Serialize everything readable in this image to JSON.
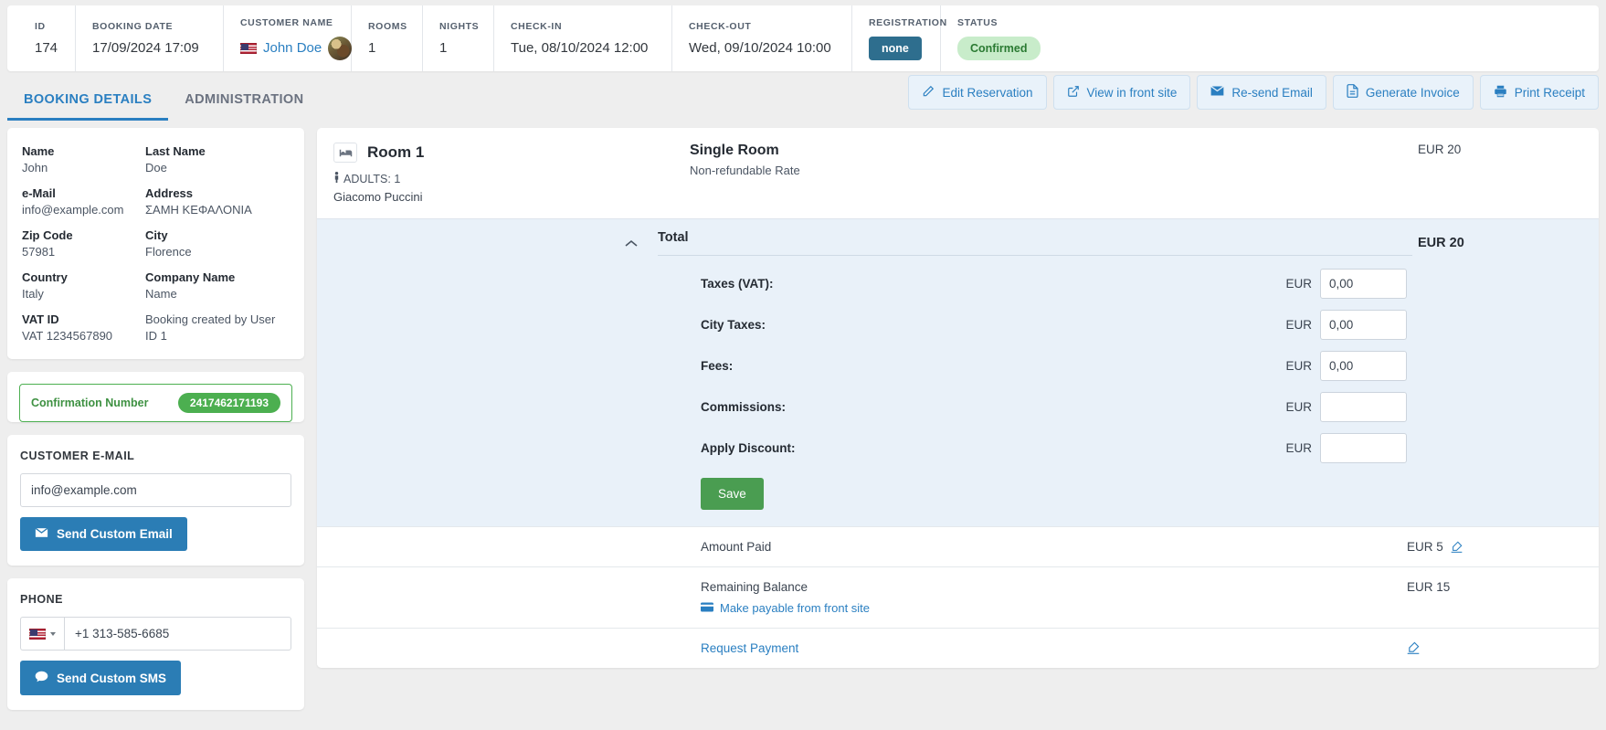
{
  "header": {
    "cells": [
      {
        "label": "ID",
        "value": "174"
      },
      {
        "label": "BOOKING DATE",
        "value": "17/09/2024 17:09"
      },
      {
        "label": "CUSTOMER NAME",
        "value": "John Doe"
      },
      {
        "label": "ROOMS",
        "value": "1"
      },
      {
        "label": "NIGHTS",
        "value": "1"
      },
      {
        "label": "CHECK-IN",
        "value": "Tue, 08/10/2024 12:00"
      },
      {
        "label": "CHECK-OUT",
        "value": "Wed, 09/10/2024 10:00"
      },
      {
        "label": "REGISTRATION",
        "value": "none"
      },
      {
        "label": "STATUS",
        "value": "Confirmed"
      }
    ]
  },
  "tabs": [
    {
      "label": "BOOKING DETAILS",
      "active": true
    },
    {
      "label": "ADMINISTRATION",
      "active": false
    }
  ],
  "actions": [
    {
      "label": "Edit Reservation",
      "icon": "pencil-icon"
    },
    {
      "label": "View in front site",
      "icon": "external-link-icon"
    },
    {
      "label": "Re-send Email",
      "icon": "envelope-icon"
    },
    {
      "label": "Generate Invoice",
      "icon": "document-icon"
    },
    {
      "label": "Print Receipt",
      "icon": "printer-icon"
    }
  ],
  "customer": {
    "fields": [
      {
        "label": "Name",
        "value": "John"
      },
      {
        "label": "Last Name",
        "value": "Doe"
      },
      {
        "label": "e-Mail",
        "value": "info@example.com"
      },
      {
        "label": "Address",
        "value": "ΣΑΜΗ ΚΕΦΑΛΟΝΙΑ"
      },
      {
        "label": "Zip Code",
        "value": "57981"
      },
      {
        "label": "City",
        "value": "Florence"
      },
      {
        "label": "Country",
        "value": "Italy"
      },
      {
        "label": "Company Name",
        "value": "Name"
      },
      {
        "label": "VAT ID",
        "value": "VAT 1234567890"
      },
      {
        "label": "Booking created by User",
        "value": "ID 1"
      }
    ]
  },
  "confirmation": {
    "label": "Confirmation Number",
    "number": "2417462171193"
  },
  "email_panel": {
    "title": "CUSTOMER E-MAIL",
    "value": "info@example.com",
    "placeholder": "info@example.com",
    "button": "Send Custom Email"
  },
  "phone_panel": {
    "title": "PHONE",
    "value": "+1 313-585-6685",
    "placeholder": "+1 313-585-6685",
    "button": "Send Custom SMS"
  },
  "room": {
    "title": "Room 1",
    "adults": "ADULTS: 1",
    "guest": "Giacomo Puccini",
    "rate_name": "Single Room",
    "rate_sub": "Non-refundable Rate",
    "price": "EUR 20"
  },
  "total": {
    "label": "Total",
    "amount": "EUR 20",
    "currency": "EUR",
    "lines": [
      {
        "label": "Taxes (VAT):",
        "currency": "EUR",
        "value": "0,00"
      },
      {
        "label": "City Taxes:",
        "currency": "EUR",
        "value": "0,00"
      },
      {
        "label": "Fees:",
        "currency": "EUR",
        "value": "0,00"
      },
      {
        "label": "Commissions:",
        "currency": "EUR",
        "value": ""
      },
      {
        "label": "Apply Discount:",
        "currency": "EUR",
        "value": ""
      }
    ],
    "save_label": "Save"
  },
  "payments": {
    "amount_paid_label": "Amount Paid",
    "amount_paid_value": "EUR 5",
    "remaining_label": "Remaining Balance",
    "remaining_value": "EUR 15",
    "make_payable_label": "Make payable from front site",
    "request_payment_label": "Request Payment"
  },
  "colors": {
    "accent_blue": "#2a7fc1",
    "green": "#4caf50",
    "registration_badge": "#2e6e8e",
    "status_badge_bg": "#c8ecca",
    "status_badge_text": "#2a7a32",
    "total_bg": "#e9f1f9",
    "save_green": "#4a9d51"
  }
}
